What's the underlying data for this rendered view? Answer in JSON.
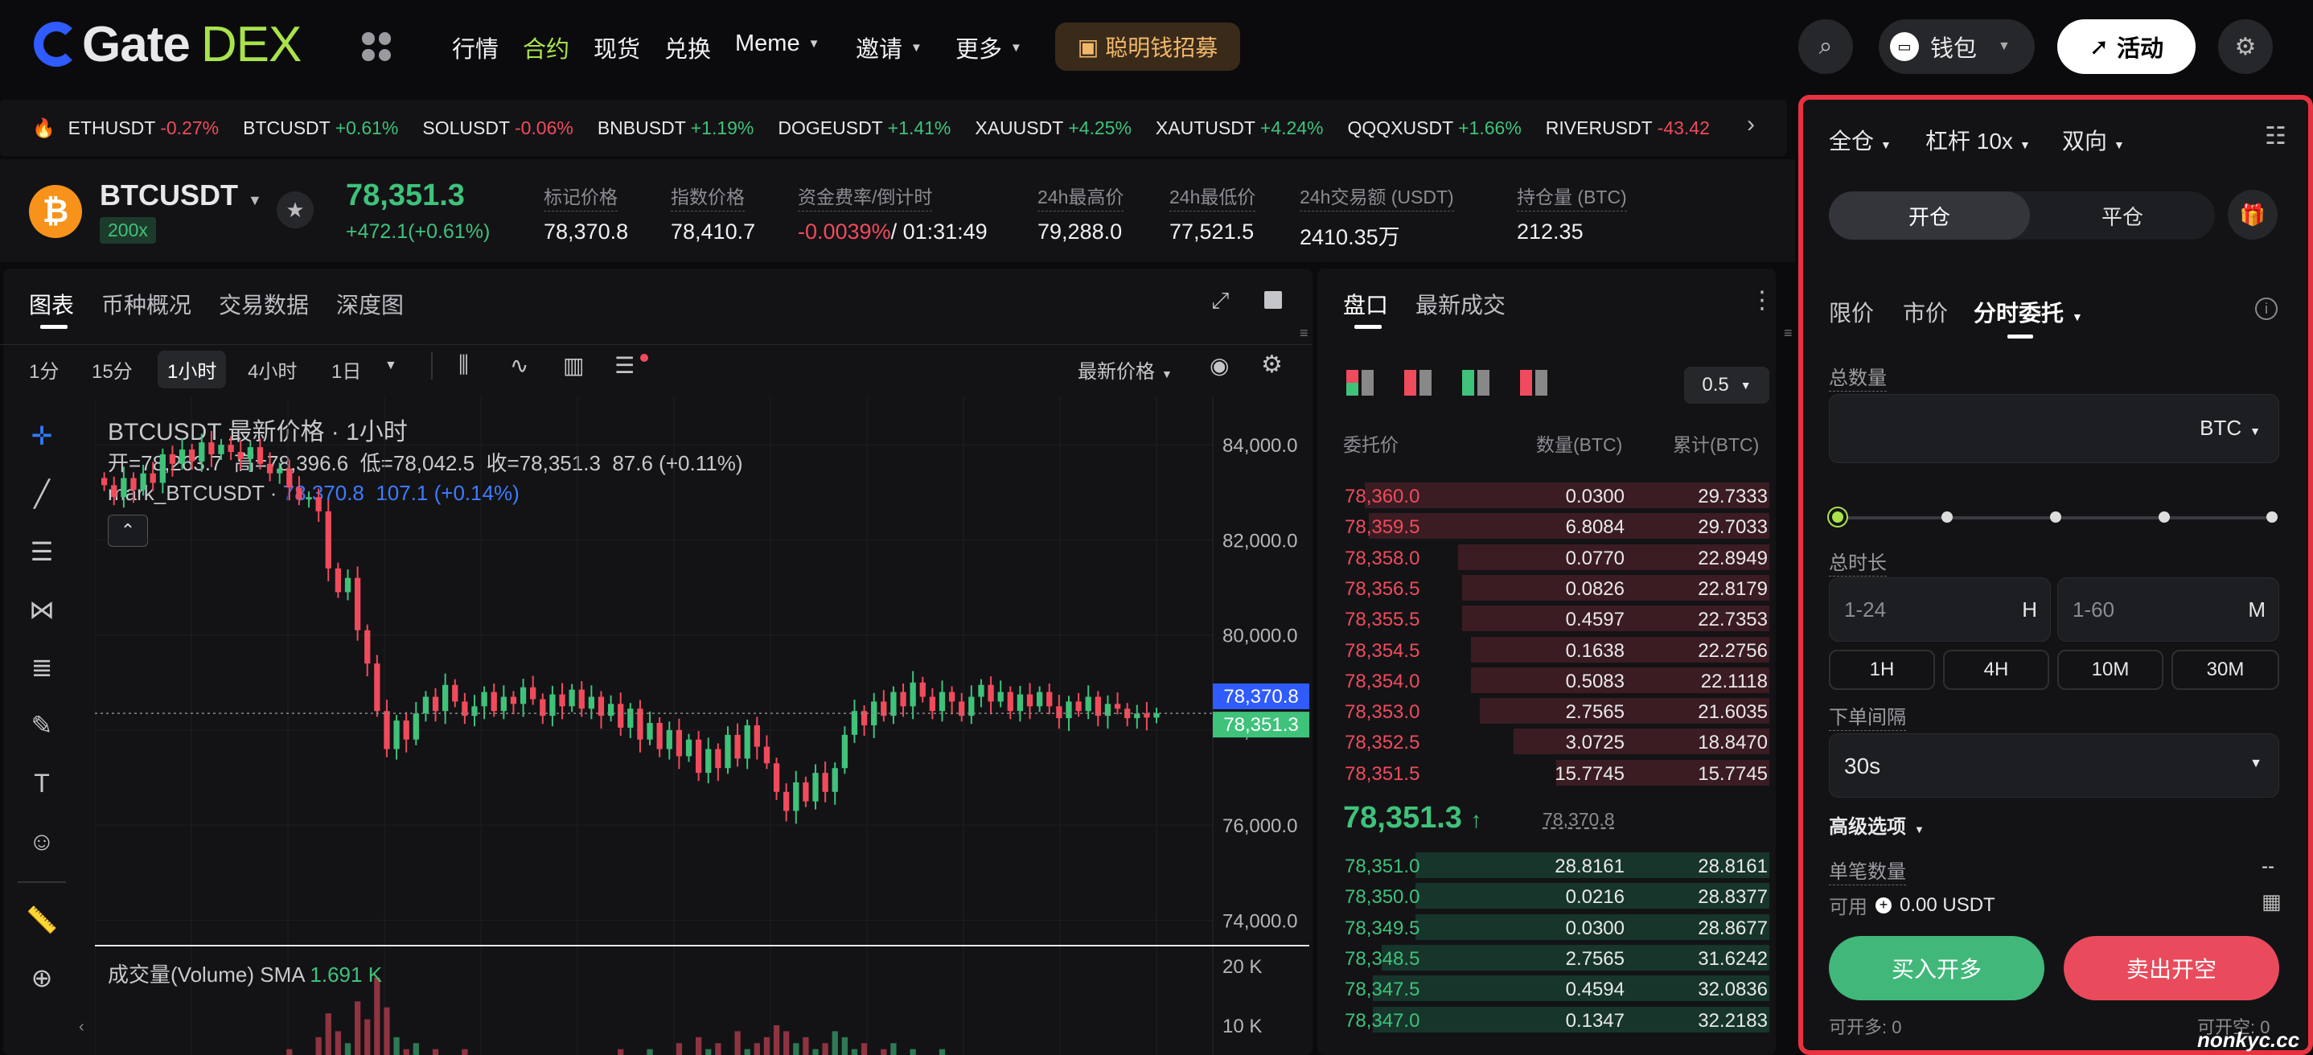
{
  "nav": {
    "logo_gate": "Gate",
    "logo_dex": "DEX",
    "items": [
      "行情",
      "合约",
      "现货",
      "兑换",
      "Meme",
      "邀请",
      "更多"
    ],
    "promo": "聪明钱招募",
    "wallet": "钱包",
    "activity": "活动",
    "active_color": "#a9e34b"
  },
  "ticker": [
    {
      "sym": "ETHUSDT",
      "chg": "-0.27%",
      "up": false
    },
    {
      "sym": "BTCUSDT",
      "chg": "+0.61%",
      "up": true
    },
    {
      "sym": "SOLUSDT",
      "chg": "-0.06%",
      "up": false
    },
    {
      "sym": "BNBUSDT",
      "chg": "+1.19%",
      "up": true
    },
    {
      "sym": "DOGEUSDT",
      "chg": "+1.41%",
      "up": true
    },
    {
      "sym": "XAUUSDT",
      "chg": "+4.25%",
      "up": true
    },
    {
      "sym": "XAUTUSDT",
      "chg": "+4.24%",
      "up": true
    },
    {
      "sym": "QQQXUSDT",
      "chg": "+1.66%",
      "up": true
    },
    {
      "sym": "RIVERUSDT",
      "chg": "-43.42",
      "up": false
    }
  ],
  "pair": {
    "symbol": "BTCUSDT",
    "leverage_badge": "200x",
    "last_price": "78,351.3",
    "change": "+472.1(+0.61%)",
    "stats": [
      {
        "label": "标记价格",
        "value": "78,370.8"
      },
      {
        "label": "指数价格",
        "value": "78,410.7"
      },
      {
        "label": "资金费率/倒计时",
        "value_a": "-0.0039%",
        "value_b": "/ 01:31:49"
      },
      {
        "label": "24h最高价",
        "value": "79,288.0"
      },
      {
        "label": "24h最低价",
        "value": "77,521.5"
      },
      {
        "label": "24h交易额 (USDT)",
        "value": "2410.35万"
      },
      {
        "label": "持仓量 (BTC)",
        "value": "212.35"
      }
    ]
  },
  "chart_tabs": [
    "图表",
    "币种概况",
    "交易数据",
    "深度图"
  ],
  "timeframes": [
    "1分",
    "15分",
    "1小时",
    "4小时",
    "1日"
  ],
  "price_type": "最新价格",
  "chart_header": {
    "title": "BTCUSDT 最新价格 · 1小时",
    "ohlc": "开=78,263.7  高=78,396.6  低=78,042.5  收=78,351.3  87.6 (+0.11%)",
    "mark_label": "mark_BTCUSDT ·",
    "mark_value": "78,370.8  107.1 (+0.14%)",
    "volume_label": "成交量(Volume) SMA",
    "volume_value": "1.691 K"
  },
  "chart_data": {
    "type": "candlestick",
    "title": "BTCUSDT 最新价格 · 1小时",
    "ylim": [
      73500,
      85000
    ],
    "y_ticks": [
      "84,000.0",
      "82,000.0",
      "80,000.0",
      "78,000.0",
      "76,000.0",
      "74,000.0"
    ],
    "y_tick_values": [
      84000,
      82000,
      80000,
      78000,
      76000,
      74000
    ],
    "vol_ticks": [
      "20 K",
      "10 K"
    ],
    "vol_tick_values": [
      20,
      10
    ],
    "mark_price_tag": "78,370.8",
    "last_price_tag": "78,351.3",
    "mark_price": 78370.8,
    "last_price": 78351.3,
    "up_color": "#3fc27a",
    "down_color": "#f04b5c",
    "closes": [
      83150,
      82900,
      83300,
      83050,
      83400,
      83200,
      83800,
      83600,
      83900,
      83650,
      84050,
      83800,
      84000,
      83850,
      83700,
      83950,
      83600,
      83400,
      83500,
      83100,
      82850,
      82900,
      82600,
      81400,
      80900,
      81200,
      80100,
      79400,
      78400,
      77600,
      78200,
      77800,
      78350,
      78700,
      78400,
      78950,
      78600,
      78300,
      78500,
      78800,
      78400,
      78700,
      78550,
      78900,
      78650,
      78300,
      78750,
      78500,
      78850,
      78450,
      78700,
      78300,
      78550,
      78050,
      78450,
      77800,
      78150,
      77600,
      78000,
      77450,
      77800,
      77100,
      77600,
      77200,
      77900,
      77400,
      78100,
      77650,
      77300,
      76700,
      76300,
      76900,
      76500,
      77100,
      76700,
      77200,
      77900,
      78400,
      78100,
      78600,
      78300,
      78800,
      78500,
      79000,
      78700,
      78400,
      78800,
      78600,
      78300,
      78700,
      78950,
      78600,
      78800,
      78400,
      78750,
      78500,
      78800,
      78500,
      78250,
      78600,
      78400,
      78700,
      78300,
      78550,
      78450,
      78250,
      78350,
      78263,
      78351
    ],
    "volumes": [
      3,
      2,
      4,
      3,
      2,
      5,
      3,
      2,
      4,
      3,
      2,
      3,
      4,
      2,
      3,
      2,
      4,
      5,
      3,
      6,
      4,
      5,
      8,
      12,
      9,
      7,
      14,
      11,
      18,
      13,
      8,
      6,
      7,
      5,
      6,
      4,
      5,
      6,
      4,
      3,
      5,
      4,
      3,
      4,
      5,
      3,
      4,
      5,
      3,
      4,
      3,
      5,
      4,
      6,
      4,
      5,
      6,
      4,
      5,
      7,
      5,
      8,
      6,
      7,
      5,
      9,
      6,
      7,
      8,
      10,
      9,
      7,
      8,
      6,
      7,
      9,
      8,
      6,
      7,
      5,
      6,
      7,
      5,
      6,
      4,
      5,
      6,
      4,
      5,
      4,
      5,
      3,
      4,
      5,
      3,
      4,
      3,
      4,
      3,
      2,
      3,
      2,
      3,
      2,
      3,
      2,
      3,
      2,
      2
    ]
  },
  "orderbook": {
    "tabs": [
      "盘口",
      "最新成交"
    ],
    "precision": "0.5",
    "headers": [
      "委托价",
      "数量(BTC)",
      "累计(BTC)"
    ],
    "asks": [
      {
        "p": "78,360.0",
        "q": "0.0300",
        "t": "29.7333",
        "depth": 0.95
      },
      {
        "p": "78,359.5",
        "q": "6.8084",
        "t": "29.7033",
        "depth": 0.94
      },
      {
        "p": "78,358.0",
        "q": "0.0770",
        "t": "22.8949",
        "depth": 0.73
      },
      {
        "p": "78,356.5",
        "q": "0.0826",
        "t": "22.8179",
        "depth": 0.72
      },
      {
        "p": "78,355.5",
        "q": "0.4597",
        "t": "22.7353",
        "depth": 0.72
      },
      {
        "p": "78,354.5",
        "q": "0.1638",
        "t": "22.2756",
        "depth": 0.7
      },
      {
        "p": "78,354.0",
        "q": "0.5083",
        "t": "22.1118",
        "depth": 0.7
      },
      {
        "p": "78,353.0",
        "q": "2.7565",
        "t": "21.6035",
        "depth": 0.68
      },
      {
        "p": "78,352.5",
        "q": "3.0725",
        "t": "18.8470",
        "depth": 0.6
      },
      {
        "p": "78,351.5",
        "q": "15.7745",
        "t": "15.7745",
        "depth": 0.5
      }
    ],
    "mid_price": "78,351.3",
    "mid_mark": "78,370.8",
    "bids": [
      {
        "p": "78,351.0",
        "q": "28.8161",
        "t": "28.8161",
        "depth": 0.83
      },
      {
        "p": "78,350.0",
        "q": "0.0216",
        "t": "28.8377",
        "depth": 0.83
      },
      {
        "p": "78,349.5",
        "q": "0.0300",
        "t": "28.8677",
        "depth": 0.83
      },
      {
        "p": "78,348.5",
        "q": "2.7565",
        "t": "31.6242",
        "depth": 0.91
      },
      {
        "p": "78,347.5",
        "q": "0.4594",
        "t": "32.0836",
        "depth": 0.93
      },
      {
        "p": "78,347.0",
        "q": "0.1347",
        "t": "32.2183",
        "depth": 0.93
      }
    ]
  },
  "order": {
    "margin_mode": "全仓",
    "leverage": "杠杆 10x",
    "position_mode": "双向",
    "open": "开仓",
    "close": "平仓",
    "types": [
      "限价",
      "市价",
      "分时委托"
    ],
    "total_qty_label": "总数量",
    "qty_unit": "BTC",
    "duration_label": "总时长",
    "hours_ph": "1-24",
    "hours_unit": "H",
    "minutes_ph": "1-60",
    "minutes_unit": "M",
    "duration_chips": [
      "1H",
      "4H",
      "10M",
      "30M"
    ],
    "interval_label": "下单间隔",
    "interval_value": "30s",
    "advanced": "高级选项",
    "single_qty_label": "单笔数量",
    "single_qty_value": "--",
    "available_label": "可用",
    "available_value": "0.00 USDT",
    "buy": "买入开多",
    "sell": "卖出开空",
    "can_long": "可开多: 0",
    "can_short": "可开空: 0"
  },
  "watermark": "nonkyc.cc"
}
